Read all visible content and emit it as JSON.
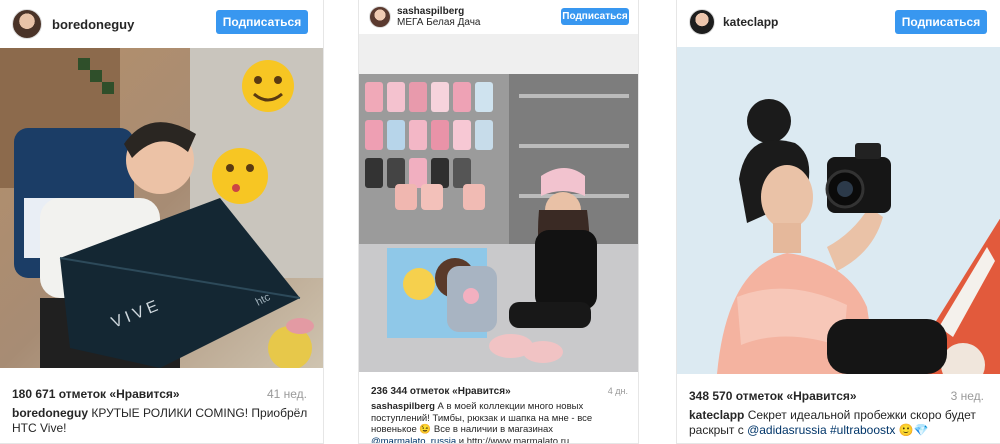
{
  "posts": [
    {
      "username": "boredoneguy",
      "follow_label": "Подписаться",
      "likes": "180 671 отметок «Нравится»",
      "age": "41 нед.",
      "caption_user": "boredoneguy",
      "caption_text": "КРУТЫЕ РОЛИКИ COMING! Приобрёл HTC Vive!",
      "photo_box_text": "VIVE",
      "photo_brand": "htc"
    },
    {
      "username": "sashaspilberg",
      "location": "МЕГА Белая Дача",
      "follow_label": "Подписаться",
      "likes": "236 344 отметок «Нравится»",
      "age": "4 дн.",
      "caption_user": "sashaspilberg",
      "caption_text_1": "А в моей коллекции много новых поступлений! Тимбы, рюкзак и шапка на мне - все новенькое",
      "caption_emoji": "😉",
      "caption_text_2": "Все в наличии в магазинах",
      "caption_mention": "@marmalato_russia",
      "caption_text_3": "и",
      "caption_link": "http://www.marmalato.ru"
    },
    {
      "username": "kateclapp",
      "follow_label": "Подписаться",
      "likes": "348 570 отметок «Нравится»",
      "age": "3 нед.",
      "caption_user": "kateclapp",
      "caption_text": "Секрет идеальной пробежки скоро будет раскрыт с",
      "caption_mention": "@adidasrussia",
      "caption_hashtag": "#ultraboostx",
      "caption_emojis": "🙂💎"
    }
  ],
  "colors": {
    "follow_button": "#3897f0",
    "link": "#003569",
    "meta_gray": "#999999"
  }
}
